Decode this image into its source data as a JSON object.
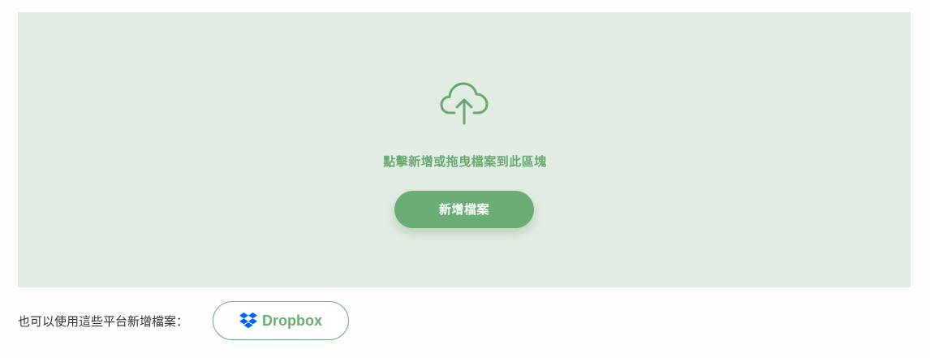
{
  "dropzone": {
    "icon": "cloud-upload-icon",
    "hint": "點擊新增或拖曳檔案到此區塊",
    "add_button_label": "新增檔案"
  },
  "alternatives": {
    "label": "也可以使用這些平台新增檔案：",
    "dropbox": {
      "icon": "dropbox-icon",
      "label": "Dropbox"
    }
  },
  "colors": {
    "accent": "#6aad75",
    "dropzone_bg": "#e1ede2",
    "dropbox_blue": "#0061fe"
  }
}
